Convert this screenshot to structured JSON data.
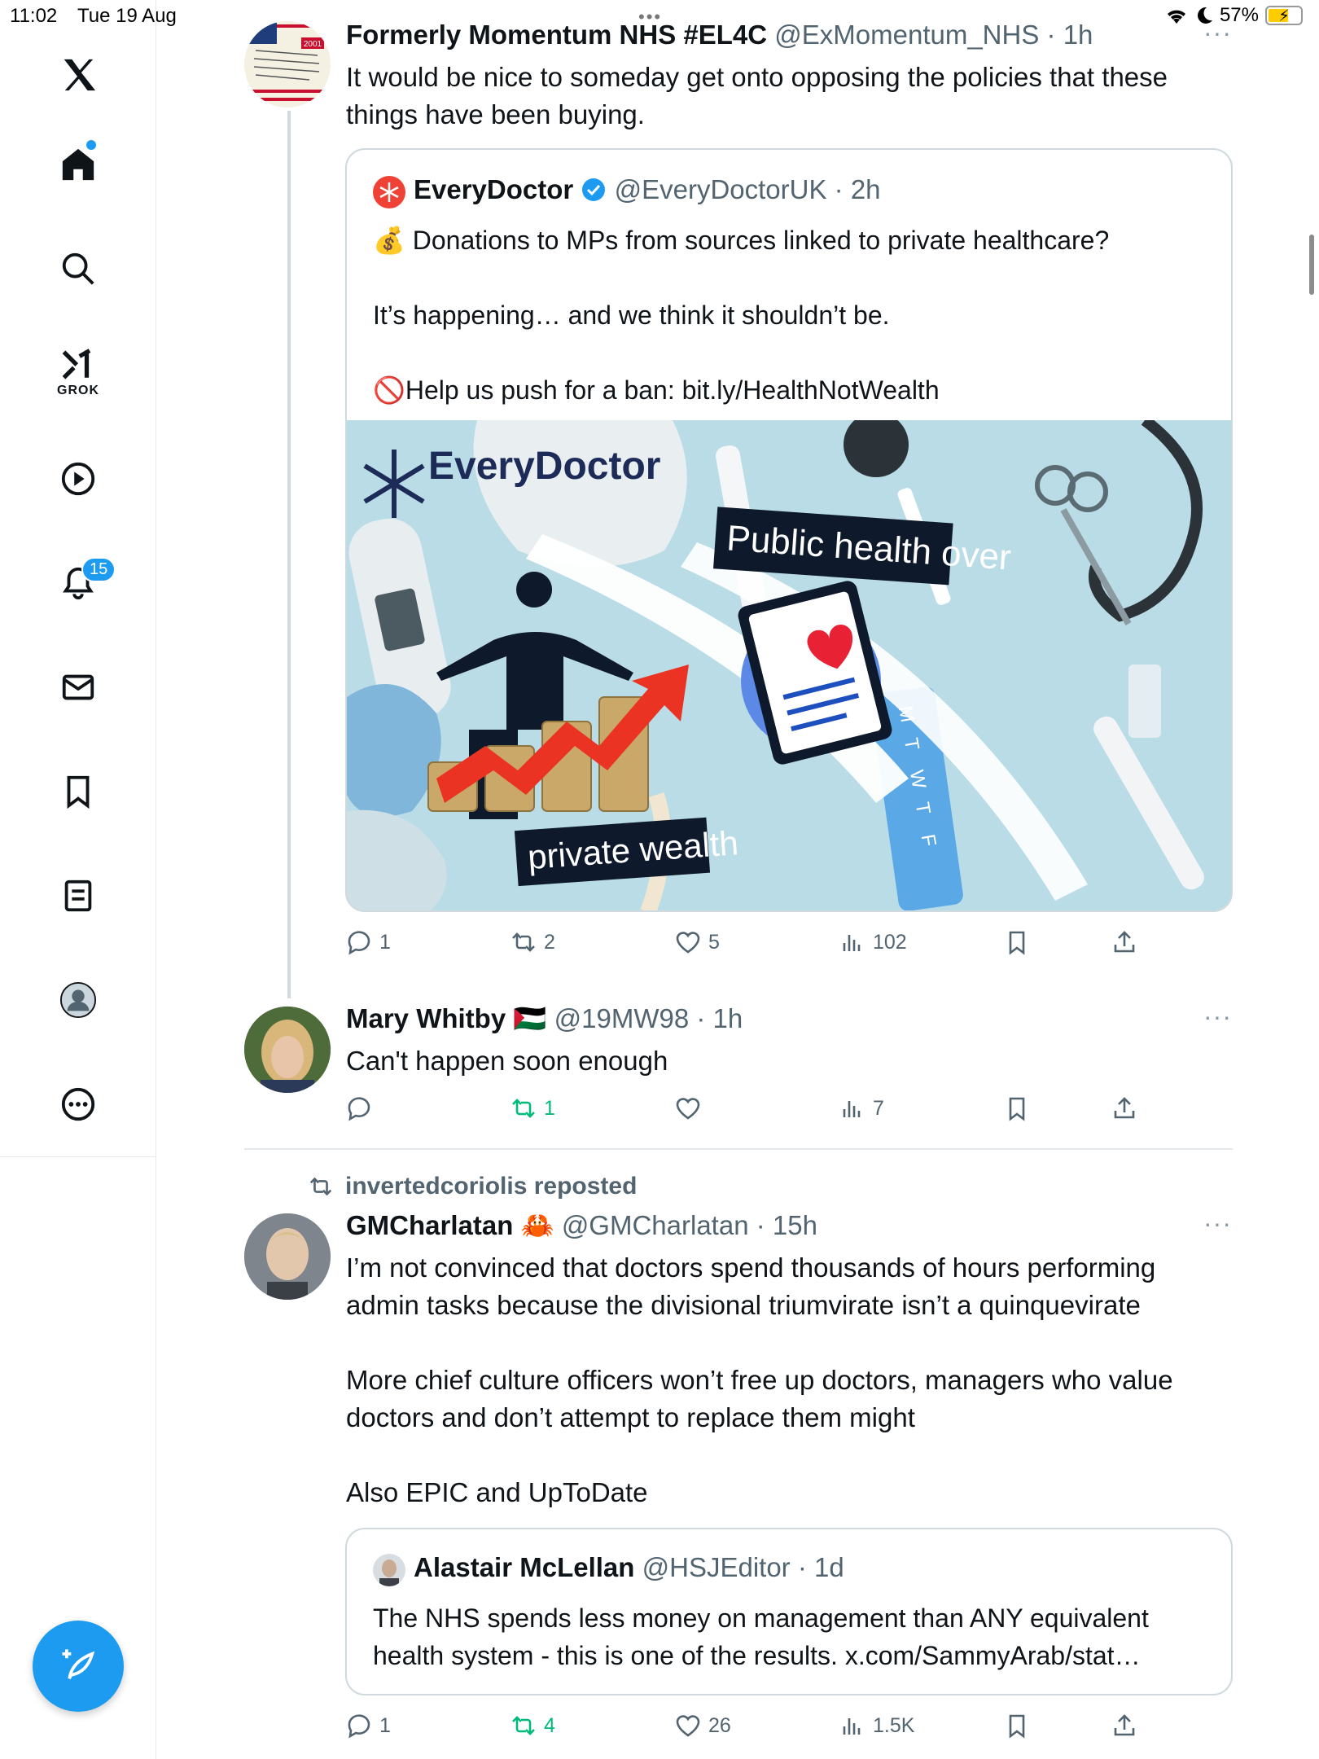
{
  "status": {
    "time": "11:02",
    "date": "Tue 19 Aug",
    "battery": "57%"
  },
  "sidebar": {
    "items": [
      "x-logo",
      "home",
      "search",
      "grok",
      "video",
      "notifications",
      "messages",
      "bookmarks",
      "lists",
      "profile",
      "more"
    ],
    "grok_label": "GROK",
    "notifications_count": "15"
  },
  "tweet1": {
    "name": "Formerly Momentum NHS #EL4C",
    "handle": "@ExMomentum_NHS",
    "time": "1h",
    "text_line1": "It would be nice to someday get onto opposing the policies that these",
    "text_line2": "things have been buying.",
    "avatar_badge": "2001",
    "quote": {
      "name": "EveryDoctor",
      "handle": "@EveryDoctorUK",
      "time": "2h",
      "line1": "Donations to MPs from sources linked to private healthcare?",
      "line2": "It’s happening… and we think it shouldn’t be.",
      "line3": "Help us push for a ban: bit.ly/HealthNotWealth",
      "line1_emoji": "💰",
      "line3_emoji": "🚫",
      "image": {
        "brand": "EveryDoctor",
        "banner_top": "Public health over",
        "banner_bottom": "private wealth",
        "pills_letters": [
          "M",
          "T",
          "W",
          "T",
          "F"
        ]
      }
    },
    "stats": {
      "replies": "1",
      "reposts": "2",
      "likes": "5",
      "views": "102"
    }
  },
  "tweet2": {
    "name": "Mary Whitby",
    "flag": "🇵🇸",
    "handle": "@19MW98",
    "time": "1h",
    "text": "Can't happen soon enough",
    "stats": {
      "replies": "",
      "reposts": "1",
      "likes": "",
      "views": "7"
    }
  },
  "tweet3": {
    "reposted_by": "invertedcoriolis reposted",
    "name": "GMCharlatan",
    "emoji": "🦀",
    "handle": "@GMCharlatan",
    "time": "15h",
    "p1_line1": "I’m not convinced that doctors spend thousands of hours performing",
    "p1_line2": "admin tasks because the divisional triumvirate isn’t a quinquevirate",
    "p2_line1": "More chief culture officers won’t free up doctors, managers who value",
    "p2_line2": "doctors and don’t attempt to replace them might",
    "p3": "Also EPIC and UpToDate",
    "quote": {
      "name": "Alastair McLellan",
      "handle": "@HSJEditor",
      "time": "1d",
      "line1": "The NHS spends less money on management than ANY equivalent",
      "line2": "health system - this is one of the results. x.com/SammyArab/stat…"
    },
    "stats": {
      "replies": "1",
      "reposts": "4",
      "likes": "26",
      "views": "1.5K"
    }
  },
  "colors": {
    "accent": "#1d9bf0",
    "repost_green": "#00ba7c",
    "muted": "#536471",
    "border": "#cfd9de"
  }
}
